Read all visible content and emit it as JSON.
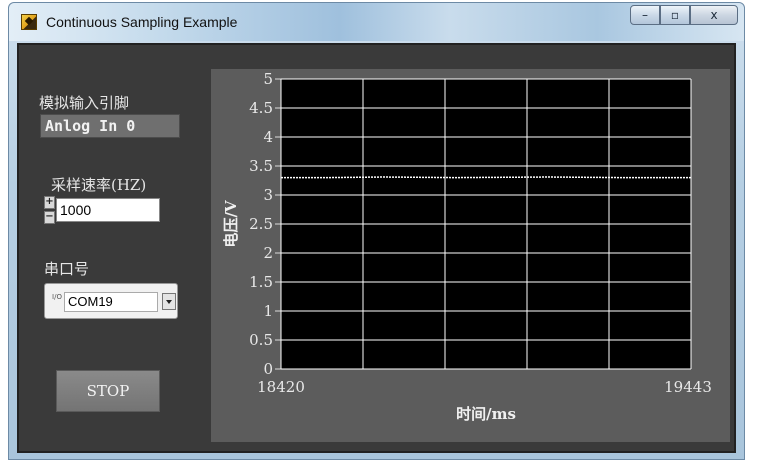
{
  "window": {
    "title": "Continuous Sampling Example",
    "buttons": {
      "minimize": "–",
      "maximize": "▫",
      "close": "x"
    }
  },
  "controls": {
    "channel": {
      "label": "模拟输入引脚",
      "value": "Anlog In 0"
    },
    "rate": {
      "label": "采样速率(HZ)",
      "value": "1000",
      "increment": "+",
      "decrement": "−"
    },
    "serial": {
      "label": "串口号",
      "value": "COM19",
      "io_prefix": "I/O"
    },
    "stop_label": "STOP"
  },
  "colors": {
    "plot_background": "#000000",
    "trace": "#ffffff",
    "grid": "#ffffff",
    "frame": "#5c5c5c"
  },
  "chart_data": {
    "type": "line",
    "title": "",
    "xlabel": "时间/ms",
    "ylabel": "电压/V",
    "xlim": [
      18420,
      19443
    ],
    "ylim": [
      0,
      5
    ],
    "x_tick_labels": [
      "18420",
      "19443"
    ],
    "y_ticks": [
      0,
      0.5,
      1,
      1.5,
      2,
      2.5,
      3,
      3.5,
      4,
      4.5,
      5
    ],
    "y_tick_labels": [
      "0",
      "0.5",
      "1",
      "1.5",
      "2",
      "2.5",
      "3",
      "3.5",
      "4",
      "4.5",
      "5"
    ],
    "grid": true,
    "series": [
      {
        "x": [
          18420,
          18538,
          18676,
          18854,
          19086,
          19270,
          19443
        ],
        "values": [
          3.3,
          3.3,
          3.31,
          3.3,
          3.31,
          3.3,
          3.3
        ]
      }
    ]
  }
}
